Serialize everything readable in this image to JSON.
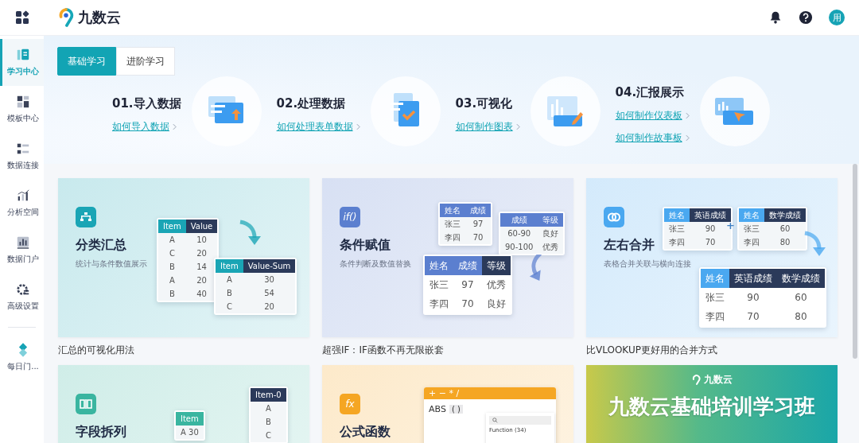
{
  "header": {
    "app_name": "九数云",
    "avatar": "用"
  },
  "sidebar": {
    "items": [
      {
        "label": "学习中心",
        "selected": true,
        "divider_before": false
      },
      {
        "label": "模板中心",
        "selected": false,
        "divider_before": false
      },
      {
        "label": "数据连接",
        "selected": false,
        "divider_before": false
      },
      {
        "label": "分析空间",
        "selected": false,
        "divider_before": false
      },
      {
        "label": "数据门户",
        "selected": false,
        "divider_before": false
      },
      {
        "label": "高级设置",
        "selected": false,
        "divider_before": false
      },
      {
        "label": "每日门...",
        "selected": false,
        "divider_before": true
      }
    ]
  },
  "tabs": [
    {
      "label": "基础学习",
      "selected": true
    },
    {
      "label": "进阶学习",
      "selected": false
    }
  ],
  "steps": [
    {
      "title": "01.导入数据",
      "links": [
        "如何导入数据"
      ]
    },
    {
      "title": "02.处理数据",
      "links": [
        "如何处理表单数据"
      ]
    },
    {
      "title": "03.可视化",
      "links": [
        "如何制作图表"
      ]
    },
    {
      "title": "04.汇报展示",
      "links": [
        "如何制作仪表板",
        "如何制作故事板"
      ]
    }
  ],
  "cards": [
    {
      "kind": "tables",
      "color": "#1aa5b5",
      "title": "分类汇总",
      "subtitle": "统计与条件数值展示",
      "caption": "汇总的可视化用法",
      "tables": [
        {
          "columns": [
            {
              "text": "Item",
              "dark": false
            },
            {
              "text": "Value",
              "dark": true
            }
          ],
          "rows": [
            [
              "A",
              "10"
            ],
            [
              "C",
              "20"
            ],
            [
              "B",
              "14"
            ],
            [
              "A",
              "20"
            ],
            [
              "B",
              "40"
            ]
          ]
        },
        {
          "columns": [
            {
              "text": "Item",
              "dark": false
            },
            {
              "text": "Value-Sum",
              "dark": true
            }
          ],
          "rows": [
            [
              "A",
              "30"
            ],
            [
              "B",
              "54"
            ],
            [
              "C",
              "20"
            ]
          ]
        }
      ]
    },
    {
      "kind": "tables",
      "color": "#5b7fcf",
      "icon_text": "if()",
      "title": "条件赋值",
      "subtitle": "条件判断及数值替换",
      "caption": "超强IF：IF函数不再无限嵌套",
      "tables": [
        {
          "columns": [
            {
              "text": "姓名",
              "dark": false
            },
            {
              "text": "成绩",
              "dark": false
            }
          ],
          "rows": [
            [
              "张三",
              "97"
            ],
            [
              "李四",
              "70"
            ]
          ]
        },
        {
          "columns": [
            {
              "text": "成绩",
              "dark": false
            },
            {
              "text": "等级",
              "dark": false
            }
          ],
          "rows": [
            [
              "60-90",
              "良好"
            ],
            [
              "90-100",
              "优秀"
            ]
          ]
        },
        {
          "columns": [
            {
              "text": "姓名",
              "dark": false
            },
            {
              "text": "成绩",
              "dark": false
            },
            {
              "text": "等级",
              "dark": true
            }
          ],
          "rows": [
            [
              "张三",
              "97",
              "优秀"
            ],
            [
              "李四",
              "70",
              "良好"
            ]
          ]
        }
      ]
    },
    {
      "kind": "tables",
      "color": "#4aa8f0",
      "title": "左右合并",
      "subtitle": "表格合并关联与横向连接",
      "caption": "比VLOOKUP更好用的合并方式",
      "joiner": "+",
      "tables": [
        {
          "columns": [
            {
              "text": "姓名",
              "dark": false
            },
            {
              "text": "英语成绩",
              "dark": true
            }
          ],
          "rows": [
            [
              "张三",
              "90"
            ],
            [
              "李四",
              "70"
            ]
          ]
        },
        {
          "columns": [
            {
              "text": "姓名",
              "dark": false
            },
            {
              "text": "数学成绩",
              "dark": true
            }
          ],
          "rows": [
            [
              "张三",
              "60"
            ],
            [
              "李四",
              "80"
            ]
          ]
        },
        {
          "columns": [
            {
              "text": "姓名",
              "dark": false
            },
            {
              "text": "英语成绩",
              "dark": true
            },
            {
              "text": "数学成绩",
              "dark": true
            }
          ],
          "rows": [
            [
              "张三",
              "90",
              "60"
            ],
            [
              "李四",
              "70",
              "80"
            ]
          ]
        }
      ]
    },
    {
      "kind": "tables",
      "color": "#3ab5a0",
      "title": "字段拆列",
      "tables": [
        {
          "columns": [
            {
              "text": "Item",
              "dark": false
            }
          ],
          "rows": [
            [
              "A  30"
            ]
          ]
        },
        {
          "columns": [
            {
              "text": "Item-0",
              "dark": true
            }
          ],
          "rows": [
            [
              "A"
            ],
            [
              "B"
            ],
            [
              "C"
            ]
          ]
        }
      ]
    },
    {
      "kind": "formula",
      "color": "#f5a623",
      "icon_text": "fx",
      "title": "公式函数",
      "operators": "+ − * /",
      "function": "ABS",
      "parens": "( )",
      "list_header": "Function (34)"
    },
    {
      "kind": "banner",
      "logo": "九数云",
      "title": "九数云基础培训学习班"
    }
  ]
}
